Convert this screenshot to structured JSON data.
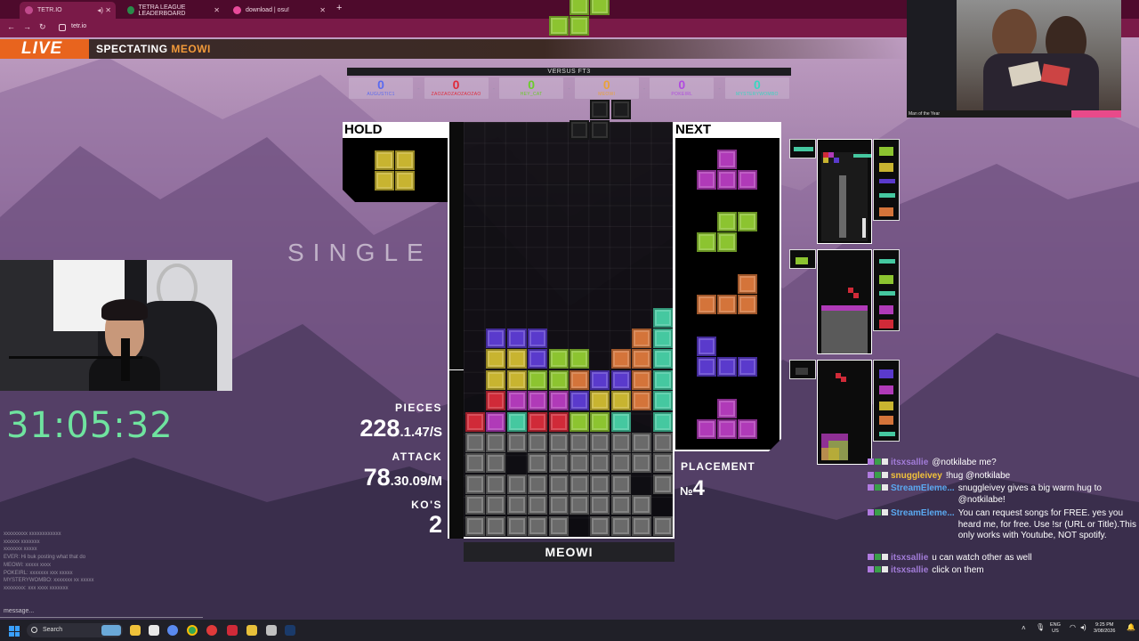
{
  "browser": {
    "tabs": [
      {
        "label": "TETR.IO",
        "color": "#c04a8c"
      },
      {
        "label": "TETRA LEAGUE LEADERBOARD",
        "color": "#2a8a4a"
      },
      {
        "label": "download | osu!",
        "color": "#e84a9a"
      }
    ],
    "url": "tetr.io"
  },
  "banner": {
    "live": "LIVE",
    "spectating_prefix": "SPECTATING ",
    "spectating_player": "MEOWI"
  },
  "cam_caption": "Man of the Year",
  "versus": {
    "title": "VERSUS FT3",
    "players": [
      {
        "score": "0",
        "name": "AUGUSTIC1",
        "color": "#5a6af0"
      },
      {
        "score": "0",
        "name": "ZAOZAOZAOZAOZAO",
        "color": "#e02a3a"
      },
      {
        "score": "0",
        "name": "HEY_CAT",
        "color": "#6acc2a"
      },
      {
        "score": "0",
        "name": "MEOWI",
        "color": "#e8a23a"
      },
      {
        "score": "0",
        "name": "POKEIRL",
        "color": "#b04ae0"
      },
      {
        "score": "0",
        "name": "MYSTERYWOMBO",
        "color": "#3ad6c0"
      }
    ]
  },
  "game": {
    "hold_label": "HOLD",
    "next_label": "NEXT",
    "clear_text": "SINGLE",
    "player_name": "MEOWI",
    "stats": {
      "pieces_label": "PIECES",
      "pieces": "228",
      "pps": ".1.47/S",
      "attack_label": "ATTACK",
      "attack": "78",
      "apm": ".30.09/M",
      "kos_label": "KO'S",
      "kos": "2"
    },
    "placement_label": "PLACEMENT",
    "placement_prefix": "№",
    "placement": "4"
  },
  "timer": "31:05:32",
  "chat_left": [
    "xxxxxxxxx xxxxxxxxxxxx",
    "xxxxxx xxxxxxx",
    "xxxxxxx xxxxx",
    "EVER: Hi buk posting what that do",
    "MEOWI: xxxxx xxxx",
    "POKEIRL: xxxxxxx xxx xxxxx",
    "MYSTERYWOMBO: xxxxxxx xx xxxxx",
    "xxxxxxxx: xxx xxxx xxxxxxx"
  ],
  "message_placeholder": "message...",
  "chat": [
    {
      "user": "itsxsallie",
      "user_color": "#a27cd8",
      "text": "@notkilabe me?"
    },
    {
      "user": "snuggleivey",
      "user_color": "#f2c23a",
      "text": "!hug @notkilabe"
    },
    {
      "user": "StreamEleme...",
      "user_color": "#5aa8f0",
      "text": "snuggleivey gives a big warm hug to @notkilabe!"
    },
    {
      "user": "StreamEleme...",
      "user_color": "#5aa8f0",
      "text": "You can request songs for FREE. yes you heard me, for free. Use !sr (URL or Title).This only works with Youtube, NOT spotify."
    },
    {
      "user": "itsxsallie",
      "user_color": "#a27cd8",
      "text": "u can watch other as well"
    },
    {
      "user": "itsxsallie",
      "user_color": "#a27cd8",
      "text": "click on them"
    }
  ],
  "taskbar": {
    "search": "Search",
    "lang_top": "ENG",
    "lang_bottom": "US",
    "time": "9:25 PM",
    "date": "3/08/2026"
  },
  "colors": {
    "I": "#45c8a0",
    "O": "#c8b430",
    "T": "#b03ab8",
    "S": "#8cc430",
    "Z": "#d02a38",
    "J": "#5a3acc",
    "L": "#d4743a",
    "G": "#6a6a6a"
  },
  "board_rows": [
    "..........",
    "..........",
    "..........",
    "..........",
    "..........",
    "..........",
    "..........",
    "..........",
    "..........",
    "..........",
    "..........",
    "..........",
    "..........",
    "..........",
    "..........",
    "..........",
    "..........",
    "..........",
    "..........",
    "..........",
    ".........I",
    ".JJJ....LI",
    ".OOJSS.LLI",
    ".OOSSLJJLI",
    ".ZTTTJOOLI",
    "ZTIZZSSI.I",
    "GGGGGGGGGG",
    "GG.GGGGGGG",
    "GGGGGGGG.G",
    "GGGGGGGGG.",
    "GGGGG.GGGG"
  ],
  "active_piece": {
    "type": "S",
    "cells": [
      [
        5,
        0
      ],
      [
        6,
        0
      ],
      [
        4,
        1
      ],
      [
        5,
        1
      ]
    ],
    "origin_row": 5,
    "origin_col": 0
  },
  "ghost": {
    "cells": [
      [
        6,
        10
      ],
      [
        7,
        10
      ],
      [
        5,
        11
      ],
      [
        6,
        11
      ]
    ]
  },
  "hold_piece": "O",
  "next_queue": [
    "T",
    "S",
    "L",
    "J",
    "T"
  ]
}
